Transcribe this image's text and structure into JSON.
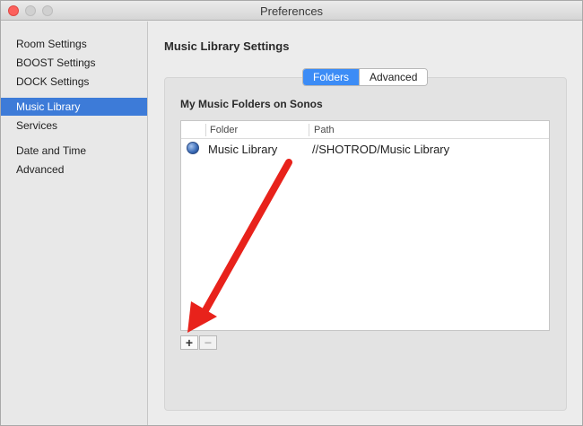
{
  "window": {
    "title": "Preferences"
  },
  "sidebar": {
    "items": [
      {
        "label": "Room Settings",
        "selected": false
      },
      {
        "label": "BOOST Settings",
        "selected": false
      },
      {
        "label": "DOCK Settings",
        "selected": false
      },
      {
        "label": "Music Library",
        "selected": true
      },
      {
        "label": "Services",
        "selected": false
      },
      {
        "label": "Date and Time",
        "selected": false
      },
      {
        "label": "Advanced",
        "selected": false
      }
    ]
  },
  "main": {
    "title": "Music Library Settings",
    "tabs": [
      {
        "label": "Folders",
        "active": true
      },
      {
        "label": "Advanced",
        "active": false
      }
    ],
    "group_heading": "My Music Folders on Sonos",
    "table": {
      "columns": [
        "Folder",
        "Path"
      ],
      "rows": [
        {
          "icon": "globe-icon",
          "folder": "Music Library",
          "path": "//SHOTROD/Music Library"
        }
      ]
    },
    "buttons": {
      "add": "+",
      "remove": "−"
    }
  },
  "colors": {
    "selection": "#3d7bd8",
    "active_tab": "#3c8cf6",
    "annotation_arrow": "#e8221b",
    "close_button": "#fc605c"
  }
}
